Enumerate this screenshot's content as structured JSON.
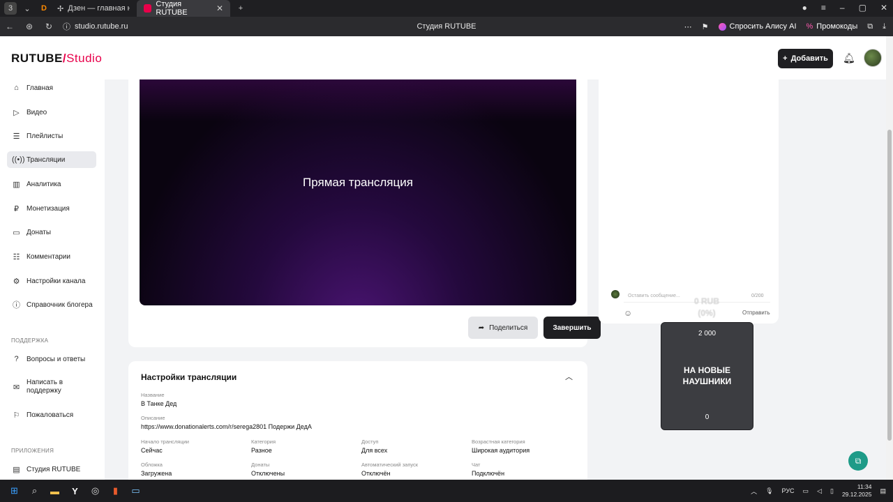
{
  "browser": {
    "tabs": [
      {
        "label": "Дзен — главная новост",
        "active": false
      },
      {
        "label": "Студия RUTUBE",
        "active": true
      }
    ],
    "url": "studio.rutube.ru",
    "page_title": "Студия RUTUBE",
    "alice_label": "Спросить Алису AI",
    "promo_label": "Промокоды"
  },
  "header": {
    "logo_main": "RUTUBE",
    "logo_sub": "Studio",
    "add_label": "Добавить"
  },
  "sidebar": {
    "items": [
      {
        "label": "Главная",
        "icon": "home-icon"
      },
      {
        "label": "Видео",
        "icon": "video-icon"
      },
      {
        "label": "Плейлисты",
        "icon": "playlist-icon"
      },
      {
        "label": "Трансляции",
        "icon": "broadcast-icon"
      },
      {
        "label": "Аналитика",
        "icon": "analytics-icon"
      },
      {
        "label": "Монетизация",
        "icon": "monetization-icon"
      },
      {
        "label": "Донаты",
        "icon": "donations-icon"
      },
      {
        "label": "Комментарии",
        "icon": "comments-icon"
      },
      {
        "label": "Настройки канала",
        "icon": "gear-icon"
      },
      {
        "label": "Справочник блогера",
        "icon": "book-icon"
      }
    ],
    "support_section": "ПОДДЕРЖКА",
    "support_items": [
      {
        "label": "Вопросы и ответы",
        "icon": "question-icon"
      },
      {
        "label": "Написать в поддержку",
        "icon": "mail-icon"
      },
      {
        "label": "Пожаловаться",
        "icon": "flag-icon"
      }
    ],
    "apps_section": "ПРИЛОЖЕНИЯ",
    "apps_items": [
      {
        "label": "Студия RUTUBE",
        "icon": "app-icon"
      }
    ]
  },
  "player": {
    "title": "Прямая трансляция",
    "share_label": "Поделиться",
    "finish_label": "Завершить"
  },
  "settings": {
    "title": "Настройки трансляции",
    "name_label": "Название",
    "name_value": "В Танке Дед",
    "desc_label": "Описание",
    "desc_value": "https://www.donationalerts.com/r/serega2801 Подержи ДедА",
    "fields": [
      {
        "label": "Начало трансляции",
        "value": "Сейчас"
      },
      {
        "label": "Категория",
        "value": "Разное"
      },
      {
        "label": "Доступ",
        "value": "Для всех"
      },
      {
        "label": "Возрастная категория",
        "value": "Широкая аудитория"
      },
      {
        "label": "Обложка",
        "value": "Загружена"
      },
      {
        "label": "Донаты",
        "value": "Отключены"
      },
      {
        "label": "Автоматический запуск",
        "value": "Отключён"
      },
      {
        "label": "Чат",
        "value": "Подключён"
      }
    ]
  },
  "chat": {
    "placeholder": "Оставить сообщение...",
    "counter": "0/200",
    "send_label": "Отправить"
  },
  "donation_overlay": {
    "amount": "0 RUB",
    "percent": "(0%)"
  },
  "goal_widget": {
    "target": "2 000",
    "title": "НА НОВЫЕ НАУШНИКИ",
    "current": "0"
  },
  "taskbar": {
    "lang": "РУС",
    "time": "11:34",
    "date": "29.12.2025"
  }
}
